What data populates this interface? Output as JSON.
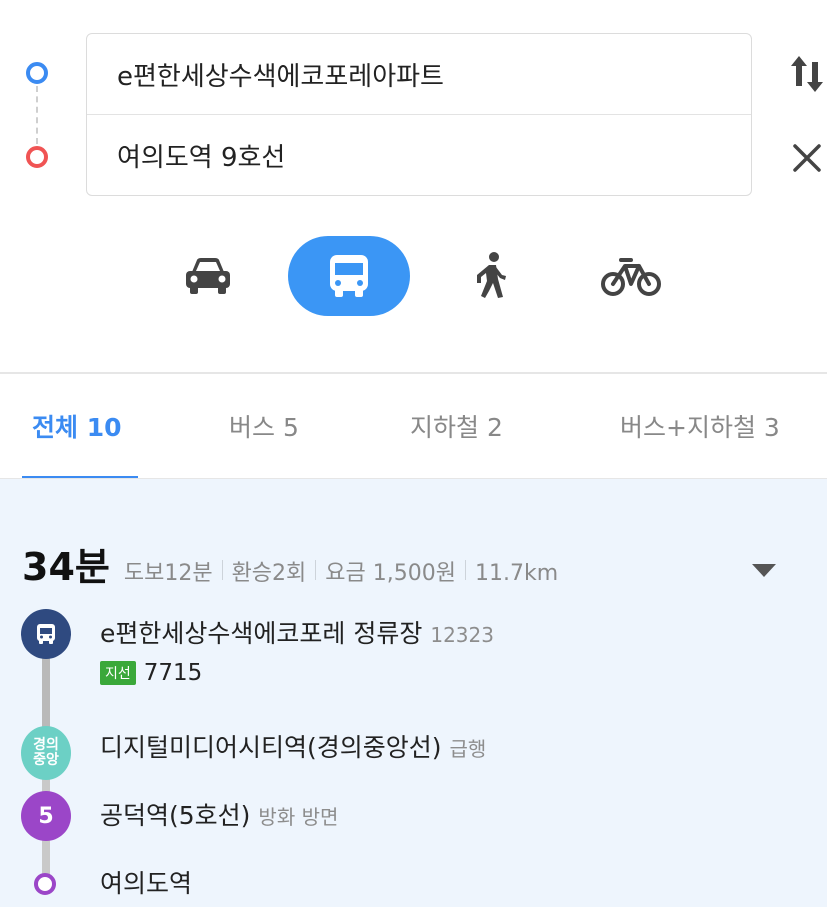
{
  "search": {
    "origin": "e편한세상수색에코포레아파트",
    "destination": "여의도역 9호선"
  },
  "icons": {
    "swap": "swap-arrows-icon",
    "close": "close-icon",
    "car": "car-icon",
    "bus": "bus-icon",
    "walk": "walking-icon",
    "bike": "bicycle-icon",
    "expand": "triangle-down-icon"
  },
  "colors": {
    "accent": "#3b8bf2",
    "origin_dot": "#3b8bf2",
    "destination_dot": "#f05454",
    "bus_node": "#2f4a80",
    "gyeongui_node": "#6cd0c5",
    "line5_node": "#9b46c8",
    "branch_badge": "#3aa83a"
  },
  "modes": {
    "selected": "bus"
  },
  "tabs": [
    {
      "label": "전체 10",
      "active": true
    },
    {
      "label": "버스 5",
      "active": false
    },
    {
      "label": "지하철 2",
      "active": false
    },
    {
      "label": "버스+지하철 3",
      "active": false
    }
  ],
  "result": {
    "duration": "34분",
    "walk": "도보12분",
    "transfer": "환승2회",
    "fare": "요금 1,500원",
    "distance": "11.7km",
    "steps": [
      {
        "name": "e편한세상수색에코포레 정류장",
        "sub": "12323"
      },
      {
        "badge": "지선",
        "number": "7715"
      },
      {
        "node_label": "경의\n중앙",
        "name": "디지털미디어시티역(경의중앙선)",
        "sub": "급행"
      },
      {
        "node_label": "5",
        "name": "공덕역(5호선)",
        "sub": "방화 방면"
      },
      {
        "name": "여의도역"
      }
    ]
  }
}
